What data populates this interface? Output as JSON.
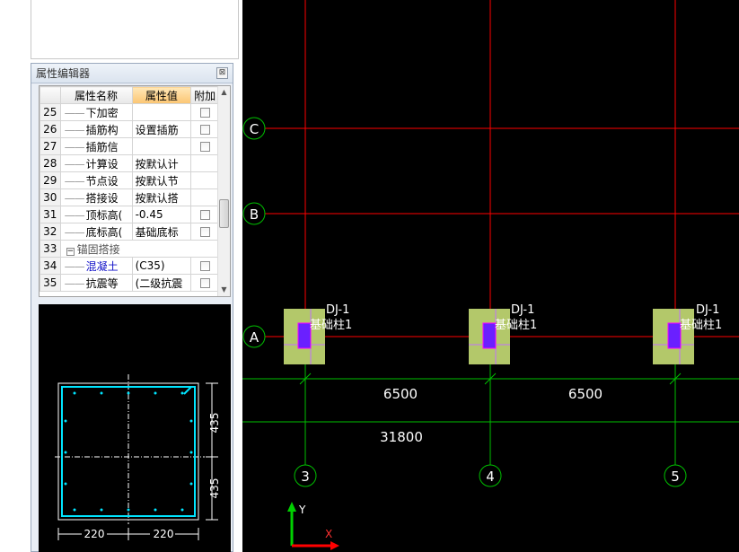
{
  "panel": {
    "title": "属性编辑器",
    "close_glyph": "⊠",
    "headers": {
      "name": "属性名称",
      "value": "属性值",
      "extra": "附加"
    },
    "rows": [
      {
        "num": "25",
        "name": "下加密",
        "value": "",
        "checkbox": true,
        "blue": false
      },
      {
        "num": "26",
        "name": "插筋构",
        "value": "设置插筋",
        "checkbox": true,
        "blue": false
      },
      {
        "num": "27",
        "name": "插筋信",
        "value": "",
        "checkbox": true,
        "blue": false
      },
      {
        "num": "28",
        "name": "计算设",
        "value": "按默认计",
        "checkbox": false,
        "blue": false
      },
      {
        "num": "29",
        "name": "节点设",
        "value": "按默认节",
        "checkbox": false,
        "blue": false
      },
      {
        "num": "30",
        "name": "搭接设",
        "value": "按默认搭",
        "checkbox": false,
        "blue": false
      },
      {
        "num": "31",
        "name": "顶标高(",
        "value": "-0.45",
        "checkbox": true,
        "blue": false
      },
      {
        "num": "32",
        "name": "底标高(",
        "value": "基础底标",
        "checkbox": true,
        "blue": false
      },
      {
        "num": "33",
        "name": "锚固搭接",
        "value": "",
        "checkbox": false,
        "group": true,
        "expander": "−"
      },
      {
        "num": "34",
        "name": "混凝土",
        "value": "(C35)",
        "checkbox": true,
        "blue": true
      },
      {
        "num": "35",
        "name": "抗震等",
        "value": "(二级抗震",
        "checkbox": true,
        "blue": false
      }
    ],
    "preview": {
      "dim_width_left": "220",
      "dim_width_right": "220",
      "dim_height_top": "435",
      "dim_height_bottom": "435"
    }
  },
  "canvas": {
    "axes_rows": [
      "C",
      "B",
      "A"
    ],
    "axes_cols": [
      "3",
      "4",
      "5"
    ],
    "column_labels": [
      {
        "code": "DJ-1",
        "name": "基础柱1"
      },
      {
        "code": "DJ-1",
        "name": "基础柱1"
      },
      {
        "code": "DJ-1",
        "name": "基础柱1"
      }
    ],
    "dims": {
      "span1": "6500",
      "span2": "6500",
      "total": "31800"
    },
    "ucs": {
      "y": "Y",
      "x": "X"
    }
  },
  "colors": {
    "grid_red": "#ff0000",
    "dim_green": "#00c000",
    "footing": "#b3c86a",
    "column": "#6a20ff",
    "preview_cyan": "#00e5ff"
  }
}
